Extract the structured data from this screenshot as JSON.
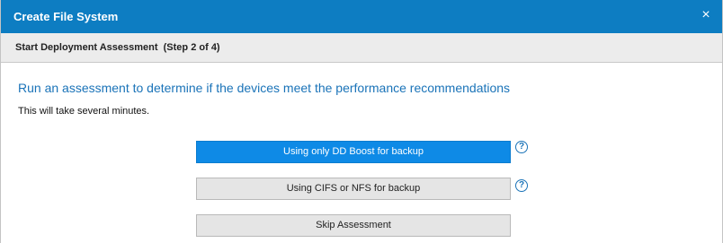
{
  "dialog": {
    "title": "Create File System",
    "close_glyph": "×",
    "step_label": "Start Deployment Assessment  (Step 2 of 4)"
  },
  "content": {
    "heading": "Run an assessment to determine if the devices meet the performance recommendations",
    "subtext": "This will take several minutes."
  },
  "options": [
    {
      "label": "Using only DD Boost for backup",
      "selected": true
    },
    {
      "label": "Using CIFS or NFS for backup",
      "selected": false
    },
    {
      "label": "Skip Assessment",
      "selected": false
    }
  ],
  "help": {
    "glyph": "?",
    "icon": "help-circle-icon"
  },
  "colors": {
    "titlebar": "#0d7dc2",
    "primary_button": "#0e8ae6",
    "heading_text": "#1a73b8",
    "secondary_button": "#e5e5e5"
  }
}
